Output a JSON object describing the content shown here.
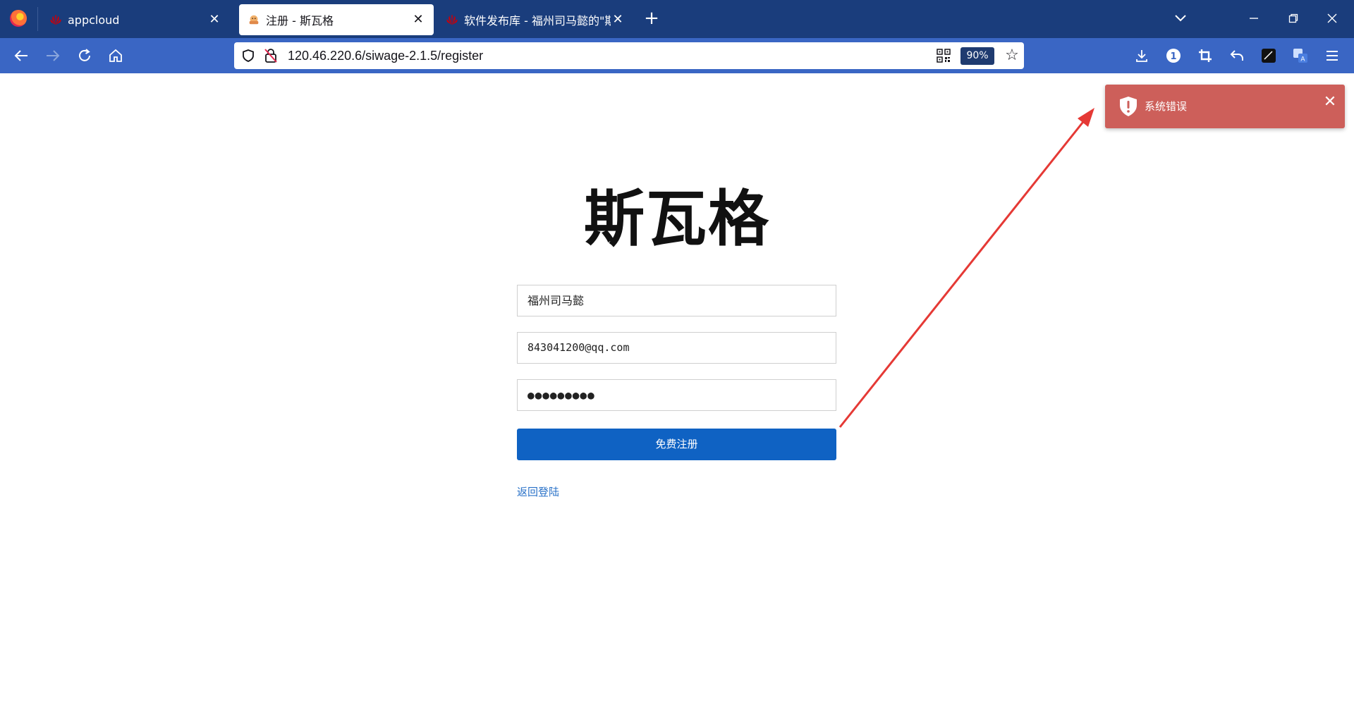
{
  "browser": {
    "tabs": [
      {
        "label": "appcloud",
        "close": "✕",
        "icon": "huawei-icon"
      },
      {
        "label": "注册 - 斯瓦格",
        "close": "✕",
        "icon": "swag-icon",
        "active": true
      },
      {
        "label": "软件发布库 - 福州司马懿的\"斯瓦",
        "close": "✕",
        "icon": "huawei-icon"
      }
    ],
    "new_tab": "+",
    "url": "120.46.220.6/siwage-2.1.5/register",
    "zoom": "90%",
    "window_controls": {
      "minimize": "—",
      "restore": "❐",
      "close": "✕"
    },
    "tab_list": "⌄",
    "extension_badge": "1"
  },
  "page": {
    "logo_text": "斯瓦格",
    "username_value": "福州司马懿",
    "email_value": "843041200@qq.com",
    "password_value": "●●●●●●●●●",
    "submit_label": "免费注册",
    "back_link": "返回登陆"
  },
  "toast": {
    "message": "系统错误",
    "close": "✕",
    "color": "#cd5f5a"
  },
  "colors": {
    "tabbar": "#1a3d7c",
    "navbar": "#3a66c4",
    "primary_button": "#0f62c3",
    "link": "#2a72c8",
    "annotation_arrow": "#e53935"
  }
}
